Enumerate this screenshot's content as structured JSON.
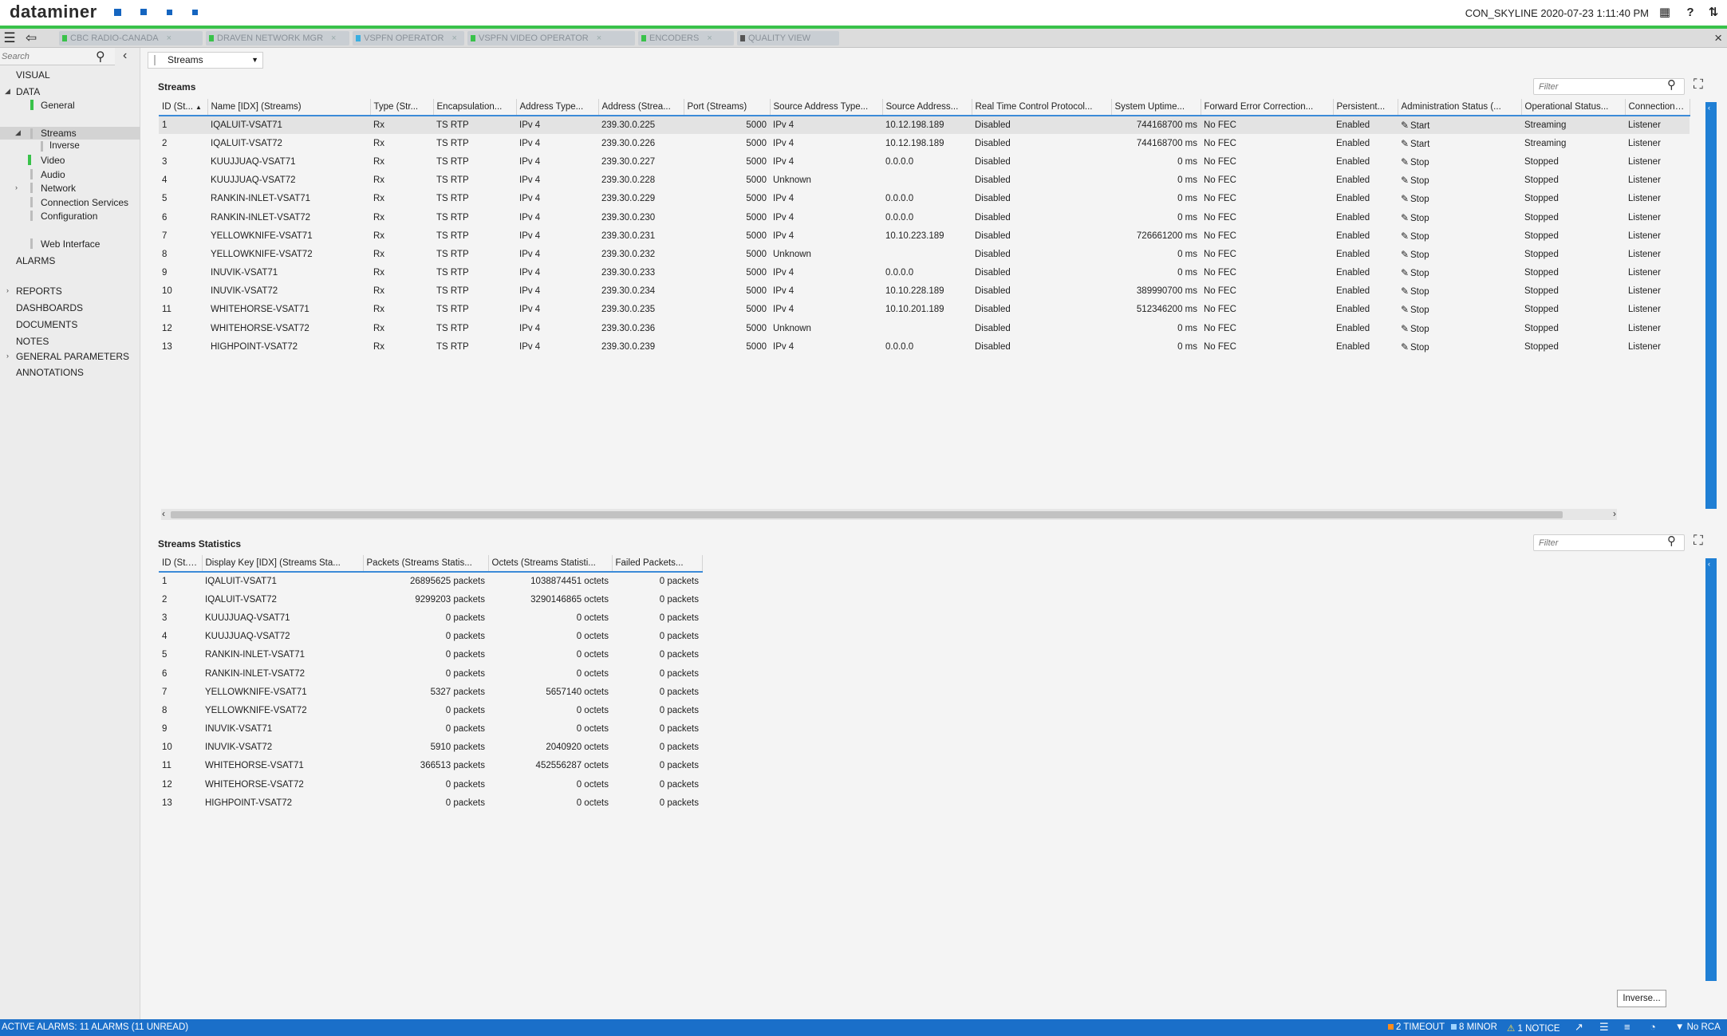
{
  "app": {
    "brand": "dataminer",
    "cluster_time": "CON_SKYLINE 2020-07-23 1:11:40 PM",
    "accent_color": "#39c24a",
    "module_square_color": "#1565c0"
  },
  "open_cards": [
    {
      "label": "CBC RADIO-CANADA",
      "dot": "#39c24a"
    },
    {
      "label": "DRAVEN NETWORK MGR",
      "dot": "#39c24a"
    },
    {
      "label": "VSPFN OPERATOR",
      "dot": "#3aaee0"
    },
    {
      "label": "VSPFN VIDEO OPERATOR",
      "dot": "#39c24a"
    },
    {
      "label": "ENCODERS",
      "dot": "#39c24a"
    },
    {
      "label": "QUALITY VIEW",
      "dot": "#555555"
    }
  ],
  "sidebar": {
    "search_placeholder": "Search",
    "visual": "VISUAL",
    "data": "DATA",
    "general": "General",
    "streams": "Streams",
    "inverse": "Inverse",
    "video": "Video",
    "audio": "Audio",
    "network": "Network",
    "connection_services": "Connection Services",
    "configuration": "Configuration",
    "web_interface": "Web Interface",
    "alarms": "ALARMS",
    "reports": "REPORTS",
    "dashboards": "DASHBOARDS",
    "documents": "DOCUMENTS",
    "notes": "NOTES",
    "general_parameters": "GENERAL PARAMETERS",
    "annotations": "ANNOTATIONS"
  },
  "page_selector": "Streams",
  "streams_panel": {
    "title": "Streams",
    "filter_placeholder": "Filter",
    "columns": [
      "ID (St...",
      "Name [IDX] (Streams)",
      "Type (Str...",
      "Encapsulation...",
      "Address Type...",
      "Address (Strea...",
      "Port (Streams)",
      "Source Address Type...",
      "Source Address...",
      "Real Time Control Protocol...",
      "System Uptime...",
      "Forward Error Correction...",
      "Persistent...",
      "Administration Status (...",
      "Operational Status...",
      "Connection Establi..."
    ],
    "rows": [
      [
        "1",
        "IQALUIT-VSAT71",
        "Rx",
        "TS RTP",
        "IPv 4",
        "239.30.0.225",
        "5000",
        "IPv 4",
        "10.12.198.189",
        "Disabled",
        "744168700 ms",
        "No FEC",
        "Enabled",
        "Start",
        "Streaming",
        "Listener"
      ],
      [
        "2",
        "IQALUIT-VSAT72",
        "Rx",
        "TS RTP",
        "IPv 4",
        "239.30.0.226",
        "5000",
        "IPv 4",
        "10.12.198.189",
        "Disabled",
        "744168700 ms",
        "No FEC",
        "Enabled",
        "Start",
        "Streaming",
        "Listener"
      ],
      [
        "3",
        "KUUJJUAQ-VSAT71",
        "Rx",
        "TS RTP",
        "IPv 4",
        "239.30.0.227",
        "5000",
        "IPv 4",
        "0.0.0.0",
        "Disabled",
        "0 ms",
        "No FEC",
        "Enabled",
        "Stop",
        "Stopped",
        "Listener"
      ],
      [
        "4",
        "KUUJJUAQ-VSAT72",
        "Rx",
        "TS RTP",
        "IPv 4",
        "239.30.0.228",
        "5000",
        "Unknown",
        "",
        "Disabled",
        "0 ms",
        "No FEC",
        "Enabled",
        "Stop",
        "Stopped",
        "Listener"
      ],
      [
        "5",
        "RANKIN-INLET-VSAT71",
        "Rx",
        "TS RTP",
        "IPv 4",
        "239.30.0.229",
        "5000",
        "IPv 4",
        "0.0.0.0",
        "Disabled",
        "0 ms",
        "No FEC",
        "Enabled",
        "Stop",
        "Stopped",
        "Listener"
      ],
      [
        "6",
        "RANKIN-INLET-VSAT72",
        "Rx",
        "TS RTP",
        "IPv 4",
        "239.30.0.230",
        "5000",
        "IPv 4",
        "0.0.0.0",
        "Disabled",
        "0 ms",
        "No FEC",
        "Enabled",
        "Stop",
        "Stopped",
        "Listener"
      ],
      [
        "7",
        "YELLOWKNIFE-VSAT71",
        "Rx",
        "TS RTP",
        "IPv 4",
        "239.30.0.231",
        "5000",
        "IPv 4",
        "10.10.223.189",
        "Disabled",
        "726661200 ms",
        "No FEC",
        "Enabled",
        "Stop",
        "Stopped",
        "Listener"
      ],
      [
        "8",
        "YELLOWKNIFE-VSAT72",
        "Rx",
        "TS RTP",
        "IPv 4",
        "239.30.0.232",
        "5000",
        "Unknown",
        "",
        "Disabled",
        "0 ms",
        "No FEC",
        "Enabled",
        "Stop",
        "Stopped",
        "Listener"
      ],
      [
        "9",
        "INUVIK-VSAT71",
        "Rx",
        "TS RTP",
        "IPv 4",
        "239.30.0.233",
        "5000",
        "IPv 4",
        "0.0.0.0",
        "Disabled",
        "0 ms",
        "No FEC",
        "Enabled",
        "Stop",
        "Stopped",
        "Listener"
      ],
      [
        "10",
        "INUVIK-VSAT72",
        "Rx",
        "TS RTP",
        "IPv 4",
        "239.30.0.234",
        "5000",
        "IPv 4",
        "10.10.228.189",
        "Disabled",
        "389990700 ms",
        "No FEC",
        "Enabled",
        "Stop",
        "Stopped",
        "Listener"
      ],
      [
        "11",
        "WHITEHORSE-VSAT71",
        "Rx",
        "TS RTP",
        "IPv 4",
        "239.30.0.235",
        "5000",
        "IPv 4",
        "10.10.201.189",
        "Disabled",
        "512346200 ms",
        "No FEC",
        "Enabled",
        "Stop",
        "Stopped",
        "Listener"
      ],
      [
        "12",
        "WHITEHORSE-VSAT72",
        "Rx",
        "TS RTP",
        "IPv 4",
        "239.30.0.236",
        "5000",
        "Unknown",
        "",
        "Disabled",
        "0 ms",
        "No FEC",
        "Enabled",
        "Stop",
        "Stopped",
        "Listener"
      ],
      [
        "13",
        "HIGHPOINT-VSAT72",
        "Rx",
        "TS RTP",
        "IPv 4",
        "239.30.0.239",
        "5000",
        "IPv 4",
        "0.0.0.0",
        "Disabled",
        "0 ms",
        "No FEC",
        "Enabled",
        "Stop",
        "Stopped",
        "Listener"
      ]
    ]
  },
  "stats_panel": {
    "title": "Streams Statistics",
    "filter_placeholder": "Filter",
    "columns": [
      "ID (St...",
      "Display Key [IDX] (Streams Sta...",
      "Packets (Streams Statis...",
      "Octets (Streams Statisti...",
      "Failed Packets..."
    ],
    "rows": [
      [
        "1",
        "IQALUIT-VSAT71",
        "26895625 packets",
        "1038874451 octets",
        "0 packets"
      ],
      [
        "2",
        "IQALUIT-VSAT72",
        "9299203 packets",
        "3290146865 octets",
        "0 packets"
      ],
      [
        "3",
        "KUUJJUAQ-VSAT71",
        "0 packets",
        "0 octets",
        "0 packets"
      ],
      [
        "4",
        "KUUJJUAQ-VSAT72",
        "0 packets",
        "0 octets",
        "0 packets"
      ],
      [
        "5",
        "RANKIN-INLET-VSAT71",
        "0 packets",
        "0 octets",
        "0 packets"
      ],
      [
        "6",
        "RANKIN-INLET-VSAT72",
        "0 packets",
        "0 octets",
        "0 packets"
      ],
      [
        "7",
        "YELLOWKNIFE-VSAT71",
        "5327 packets",
        "5657140 octets",
        "0 packets"
      ],
      [
        "8",
        "YELLOWKNIFE-VSAT72",
        "0 packets",
        "0 octets",
        "0 packets"
      ],
      [
        "9",
        "INUVIK-VSAT71",
        "0 packets",
        "0 octets",
        "0 packets"
      ],
      [
        "10",
        "INUVIK-VSAT72",
        "5910 packets",
        "2040920 octets",
        "0 packets"
      ],
      [
        "11",
        "WHITEHORSE-VSAT71",
        "366513 packets",
        "452556287 octets",
        "0 packets"
      ],
      [
        "12",
        "WHITEHORSE-VSAT72",
        "0 packets",
        "0 octets",
        "0 packets"
      ],
      [
        "13",
        "HIGHPOINT-VSAT72",
        "0 packets",
        "0 octets",
        "0 packets"
      ]
    ]
  },
  "inverse_button": "Inverse...",
  "statusbar": {
    "active_alarms": "ACTIVE ALARMS: 11 ALARMS (11 UNREAD)",
    "timeout": "2 TIMEOUT",
    "minor": "8 MINOR",
    "notice": "1 NOTICE",
    "no_rca": "No RCA",
    "timeout_color": "#ff8c1a",
    "minor_color": "#9fd4ff",
    "notice_color": "#ffe14a"
  }
}
